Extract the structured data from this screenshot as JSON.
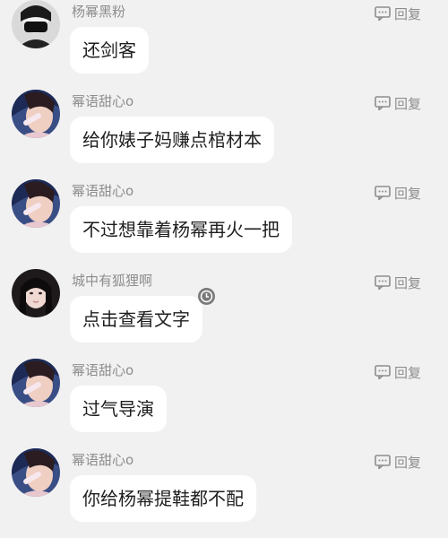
{
  "reply_label": "回复",
  "comments": [
    {
      "username": "杨幂黑粉",
      "text": "还剑客",
      "avatar_style": "masked-dark"
    },
    {
      "username": "幂语甜心o",
      "text": "给你婊子妈赚点棺材本",
      "avatar_style": "girl-selfie"
    },
    {
      "username": "幂语甜心o",
      "text": "不过想靠着杨幂再火一把",
      "avatar_style": "girl-selfie"
    },
    {
      "username": "城中有狐狸啊",
      "text": "点击查看文字",
      "avatar_style": "girl-portrait",
      "clock_icon": true
    },
    {
      "username": "幂语甜心o",
      "text": "过气导演",
      "avatar_style": "girl-selfie"
    },
    {
      "username": "幂语甜心o",
      "text": "你给杨幂提鞋都不配",
      "avatar_style": "girl-selfie"
    }
  ],
  "colors": {
    "background": "#f1f1f1",
    "bubble": "#ffffff",
    "meta_text": "#8d8d8d",
    "message_text": "#1e1e1e"
  }
}
